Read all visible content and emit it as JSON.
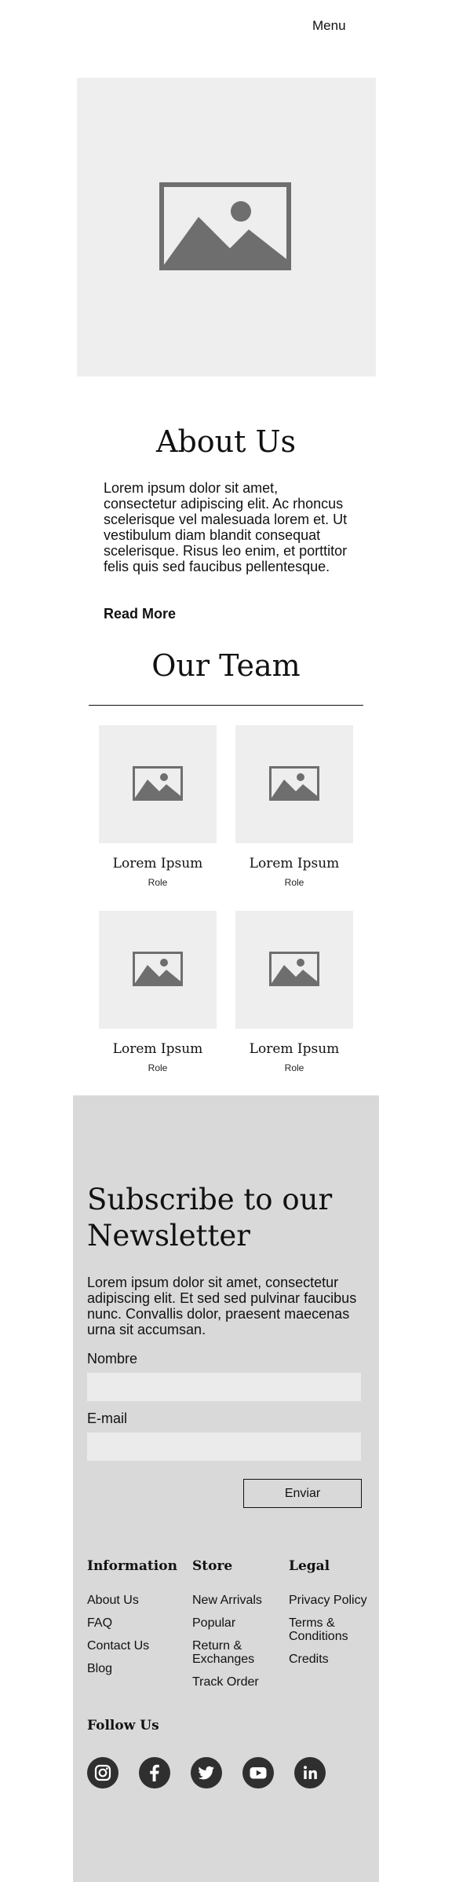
{
  "header": {
    "menu_label": "Menu"
  },
  "about": {
    "title": "About Us",
    "body": "Lorem ipsum dolor sit amet, consectetur adipiscing elit. Ac rhoncus scelerisque vel malesuada lorem et. Ut vestibulum diam blandit consequat scelerisque. Risus leo enim, et porttitor felis quis sed faucibus pellentesque.",
    "read_more": "Read More"
  },
  "team": {
    "title": "Our Team",
    "members": [
      {
        "name": "Lorem Ipsum",
        "role": "Role"
      },
      {
        "name": "Lorem Ipsum",
        "role": "Role"
      },
      {
        "name": "Lorem Ipsum",
        "role": "Role"
      },
      {
        "name": "Lorem Ipsum",
        "role": "Role"
      }
    ]
  },
  "newsletter": {
    "title": "Subscribe to our Newsletter",
    "body": "Lorem ipsum dolor sit amet, consectetur adipiscing elit. Et sed sed pulvinar faucibus nunc. Convallis dolor, praesent maecenas urna sit accumsan.",
    "name_label": "Nombre",
    "email_label": "E-mail",
    "submit_label": "Enviar"
  },
  "footer": {
    "columns": [
      {
        "title": "Information",
        "links": [
          "About Us",
          "FAQ",
          "Contact Us",
          "Blog"
        ]
      },
      {
        "title": "Store",
        "links": [
          "New Arrivals",
          "Popular",
          "Return & Exchanges",
          "Track Order"
        ]
      },
      {
        "title": "Legal",
        "links": [
          "Privacy Policy",
          "Terms & Conditions",
          "Credits"
        ]
      }
    ],
    "follow_title": "Follow Us",
    "social_icons": [
      "instagram-icon",
      "facebook-icon",
      "twitter-icon",
      "youtube-icon",
      "linkedin-icon"
    ]
  },
  "colors": {
    "placeholder_bg": "#eeeeee",
    "placeholder_icon": "#6e6e6e",
    "newsletter_bg": "#d9d9d9",
    "input_bg": "#ebebeb",
    "social_bg": "#2f2f2f"
  }
}
